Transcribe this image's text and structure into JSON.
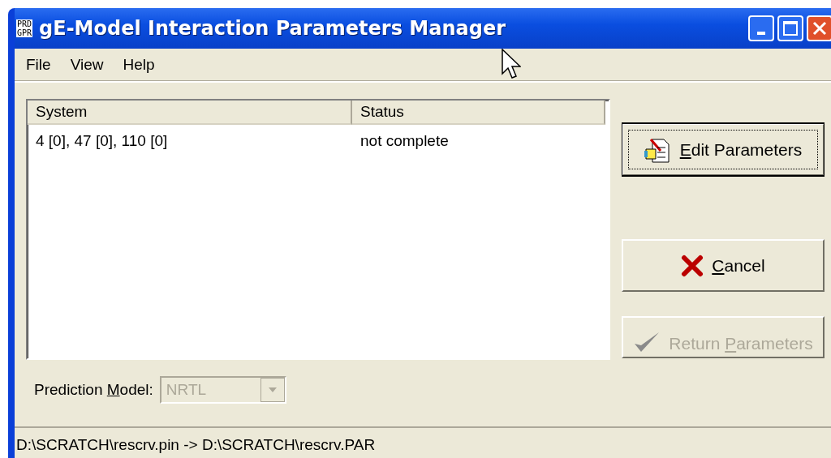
{
  "window": {
    "title": "gE-Model Interaction Parameters Manager",
    "icon_text": [
      "PRD",
      "GPR"
    ]
  },
  "menu": [
    "File",
    "View",
    "Help"
  ],
  "table": {
    "columns": [
      "System",
      "Status"
    ],
    "rows": [
      {
        "cells": [
          "4 [0], 47 [0], 110 [0]",
          "not complete"
        ],
        "selected": false
      }
    ]
  },
  "buttons": [
    {
      "kind": "edit",
      "key": "E",
      "post": "dit Parameters",
      "default": true,
      "disabled": false
    },
    {
      "kind": "cancel",
      "key": "C",
      "post": "ancel",
      "default": false,
      "disabled": false
    },
    {
      "kind": "return",
      "pre": "Return ",
      "key": "P",
      "post": "arameters",
      "default": false,
      "disabled": true
    }
  ],
  "prediction": {
    "pre": "Prediction ",
    "key": "M",
    "post": "odel:",
    "value": "NRTL",
    "disabled": true
  },
  "status_bar": "D:\\SCRATCH\\rescrv.pin -> D:\\SCRATCH\\rescrv.PAR"
}
